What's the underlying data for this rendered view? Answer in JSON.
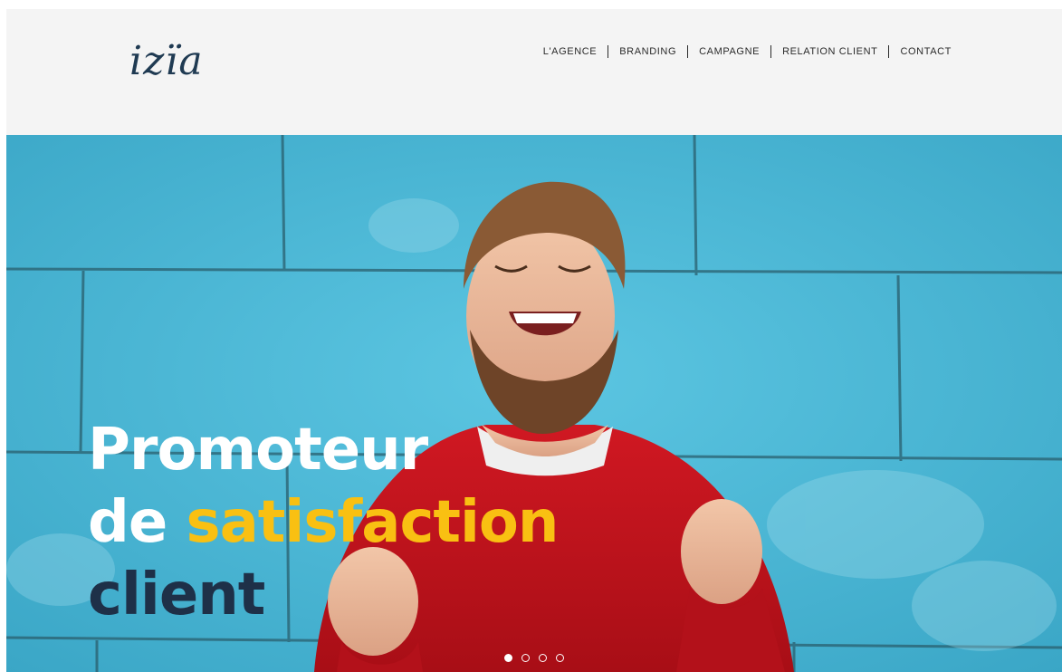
{
  "brand": {
    "logo_text": "izïa"
  },
  "nav": {
    "items": [
      {
        "label": "L'AGENCE"
      },
      {
        "label": "BRANDING"
      },
      {
        "label": "CAMPAGNE"
      },
      {
        "label": "RELATION CLIENT"
      },
      {
        "label": "CONTACT"
      }
    ]
  },
  "hero": {
    "headline": {
      "line1": "Promoteur",
      "line2_a": "de",
      "line2_b": "satisfaction",
      "line3": "client"
    },
    "slider": {
      "slide_count": 4,
      "active_slide": 1
    }
  },
  "colors": {
    "header_bg": "#f4f4f4",
    "logo": "#1f3a52",
    "accent_yellow": "#f9c012",
    "navy": "#1e3048",
    "wall_blue": "#4bb8d6",
    "sweater_red": "#c4121c"
  }
}
